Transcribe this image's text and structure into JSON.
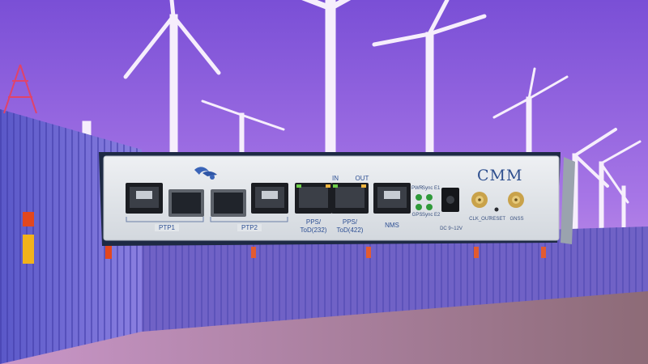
{
  "device": {
    "brand": "CMM",
    "group_ptp1": "PTP1",
    "group_ptp2": "PTP2",
    "pps_232_line1": "PPS/",
    "pps_232_line2": "ToD(232)",
    "pps_422_line1": "PPS/",
    "pps_422_line2": "ToD(422)",
    "port_in": "IN",
    "port_out": "OUT",
    "nms": "NMS",
    "led_pwr": "PWR",
    "led_sync1": "Sync E1",
    "led_gps": "GPS",
    "led_sync2": "Sync E2",
    "dc_label": "DC 9~12V",
    "clk_out": "CLK_OUT",
    "reset": "RESET",
    "gnss": "GNSS"
  },
  "colors": {
    "sky": "#8a5bd9",
    "panel": "#dfe3e8",
    "label_blue": "#2d4f93",
    "container": "#6b63c9",
    "ground": "#a07890"
  }
}
